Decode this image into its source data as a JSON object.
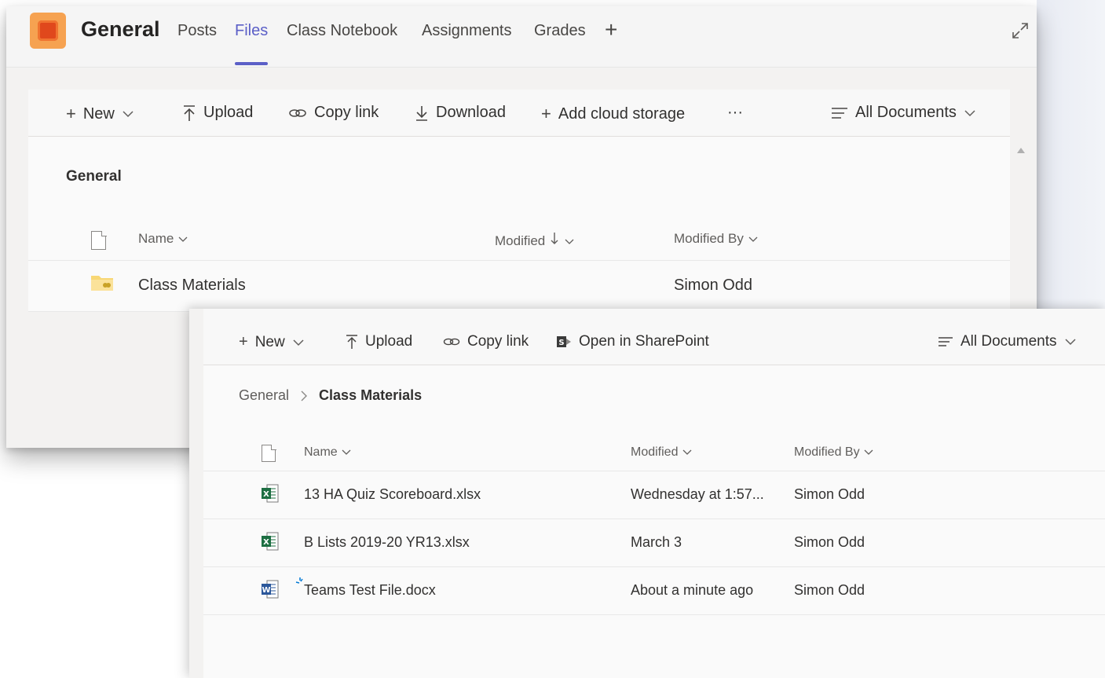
{
  "teams": {
    "team_name": "General",
    "tabs": [
      {
        "label": "Posts"
      },
      {
        "label": "Files",
        "active": true
      },
      {
        "label": "Class Notebook"
      },
      {
        "label": "Assignments"
      },
      {
        "label": "Grades"
      }
    ],
    "add_tab_glyph": "+",
    "accent_color": "#5b5fc7",
    "app_tile_color": "#f6a251"
  },
  "back_window": {
    "toolbar": {
      "new_label": "New",
      "upload_label": "Upload",
      "copy_link_label": "Copy link",
      "download_label": "Download",
      "add_cloud_label": "Add cloud storage",
      "more_label": "···",
      "view_label": "All Documents"
    },
    "section_title": "General",
    "columns": {
      "name": "Name",
      "modified": "Modified",
      "modified_by": "Modified By"
    },
    "rows": [
      {
        "name": "Class Materials",
        "type": "folder",
        "modified": "",
        "modified_by": "Simon Odd"
      }
    ]
  },
  "front_window": {
    "toolbar": {
      "new_label": "New",
      "upload_label": "Upload",
      "copy_link_label": "Copy link",
      "open_sharepoint_label": "Open in SharePoint",
      "view_label": "All Documents"
    },
    "breadcrumb": {
      "parent": "General",
      "current": "Class Materials"
    },
    "columns": {
      "name": "Name",
      "modified": "Modified",
      "modified_by": "Modified By"
    },
    "rows": [
      {
        "name": "13 HA Quiz Scoreboard.xlsx",
        "type": "excel",
        "modified": "Wednesday at 1:57...",
        "modified_by": "Simon Odd"
      },
      {
        "name": "B Lists 2019-20 YR13.xlsx",
        "type": "excel",
        "modified": "March 3",
        "modified_by": "Simon Odd"
      },
      {
        "name": "Teams Test File.docx",
        "type": "word",
        "modified": "About a minute ago",
        "modified_by": "Simon Odd"
      }
    ]
  },
  "icons": {
    "new": "plus-icon",
    "upload": "upload-icon",
    "copy_link": "link-icon",
    "download": "download-icon",
    "add_cloud": "plus-icon",
    "view": "filter-lines-icon",
    "sharepoint": "sharepoint-icon",
    "expand": "expand-icon"
  },
  "colors": {
    "excel_green": "#1d6f42",
    "word_blue": "#2b579a",
    "folder_yellow": "#f8d775"
  }
}
